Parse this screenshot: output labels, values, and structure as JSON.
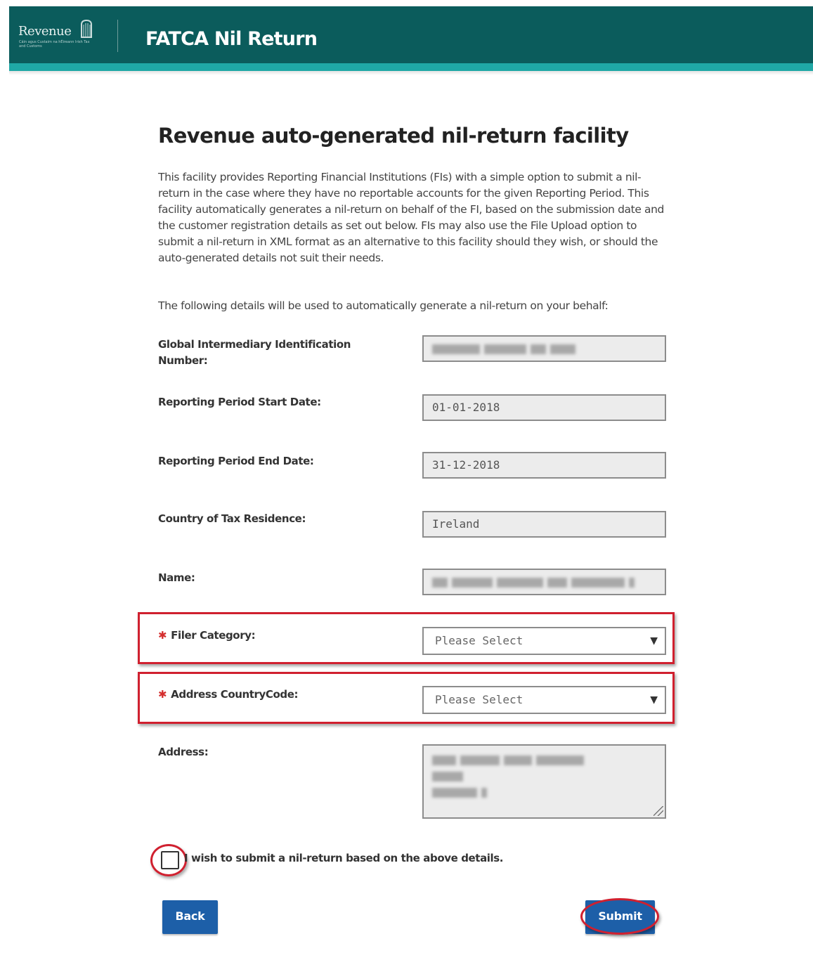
{
  "header": {
    "logo_text": "Revenue",
    "logo_subtext": "Cáin agus Custaim na hÉireann Irish Tax and Customs",
    "app_title": "FATCA Nil Return"
  },
  "colors": {
    "header_bg": "#0b5c5c",
    "header_strip": "#1fa8a6",
    "button_blue": "#1d5fa8",
    "highlight_red": "#d0202f",
    "required_red": "#d42f2f"
  },
  "main": {
    "title": "Revenue auto-generated nil-return facility",
    "intro_paragraph": "This facility provides Reporting Financial Institutions (FIs) with a simple option to submit a nil-return in the case where they have no reportable accounts for the given Reporting Period. This facility automatically generates a nil-return on behalf of the FI, based on the submission date and the customer registration details as set out below. FIs may also use the File Upload option to submit a nil-return in XML format as an alternative to this facility should they wish, or should the auto-generated details not suit their needs.",
    "details_intro": "The following details will be used to automatically generate a nil-return on your behalf:"
  },
  "form": {
    "giin_label": "Global Intermediary Identification Number:",
    "start_date_label": "Reporting Period Start Date:",
    "start_date_value": "01-01-2018",
    "end_date_label": "Reporting Period End Date:",
    "end_date_value": "31-12-2018",
    "country_label": "Country of Tax Residence:",
    "country_value": "Ireland",
    "name_label": "Name:",
    "filer_category_label": "Filer Category:",
    "filer_category_value": "Please Select",
    "address_country_label": "Address CountryCode:",
    "address_country_value": "Please Select",
    "address_label": "Address:",
    "required_marker": "✱",
    "select_arrow": "▼",
    "confirm_label": "I wish to submit a nil-return based on the above details."
  },
  "buttons": {
    "back": "Back",
    "submit": "Submit"
  }
}
